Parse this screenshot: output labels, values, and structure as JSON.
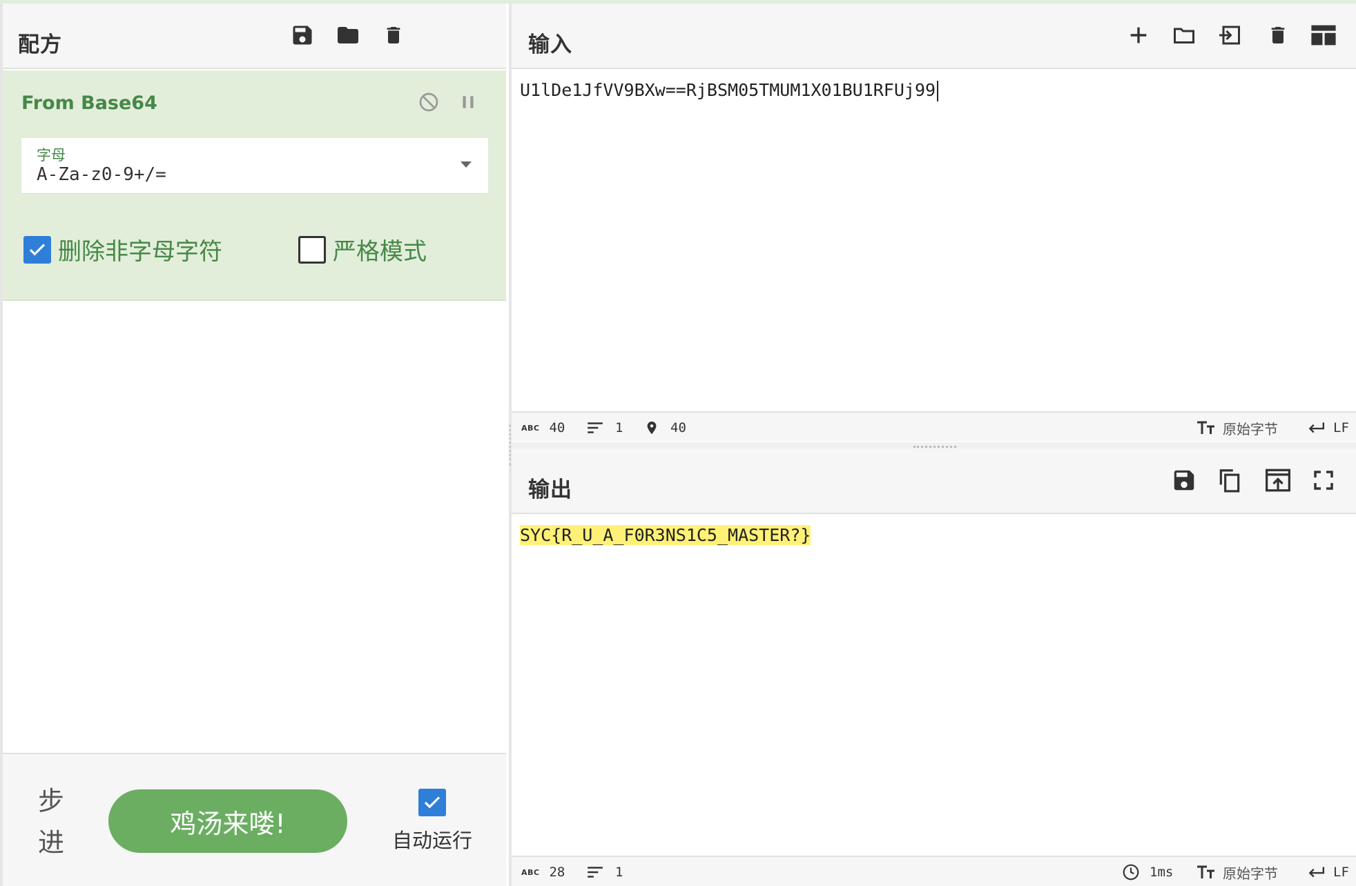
{
  "recipe": {
    "title": "配方",
    "operation": {
      "name": "From Base64",
      "alphabet_label": "字母",
      "alphabet_value": "A-Za-z0-9+/=",
      "remove_non_alphabet": {
        "label": "删除非字母字符",
        "checked": true
      },
      "strict_mode": {
        "label": "严格模式",
        "checked": false
      }
    },
    "controls": {
      "step_label": "步进",
      "bake_label": "鸡汤来喽!",
      "autobake_label": "自动运行",
      "autobake_checked": true
    }
  },
  "input": {
    "title": "输入",
    "text": "U1lDe1JfVV9BXw==RjBSM05TMUM1X01BU1RFUj99",
    "status": {
      "length": "40",
      "lines": "1",
      "position": "40",
      "encoding": "原始字节",
      "eol": "LF"
    }
  },
  "output": {
    "title": "输出",
    "text": "SYC{R_U_A_F0R3NS1C5_MASTER?}",
    "status": {
      "length": "28",
      "lines": "1",
      "time": "1ms",
      "encoding": "原始字节",
      "eol": "LF"
    }
  },
  "colors": {
    "accent": "#468847",
    "op_bg": "#e2eeda",
    "bake": "#6bae62",
    "checkbox": "#2f7ed8",
    "highlight": "#fff176"
  },
  "icons": [
    "save-icon",
    "folder-icon",
    "trash-icon",
    "disable-icon",
    "pause-icon",
    "plus-icon",
    "open-input-icon",
    "layout-icon",
    "copy-icon",
    "replace-input-icon",
    "fullscreen-icon",
    "abc-icon",
    "lines-icon",
    "location-icon",
    "text-format-icon",
    "return-icon",
    "clock-icon"
  ]
}
